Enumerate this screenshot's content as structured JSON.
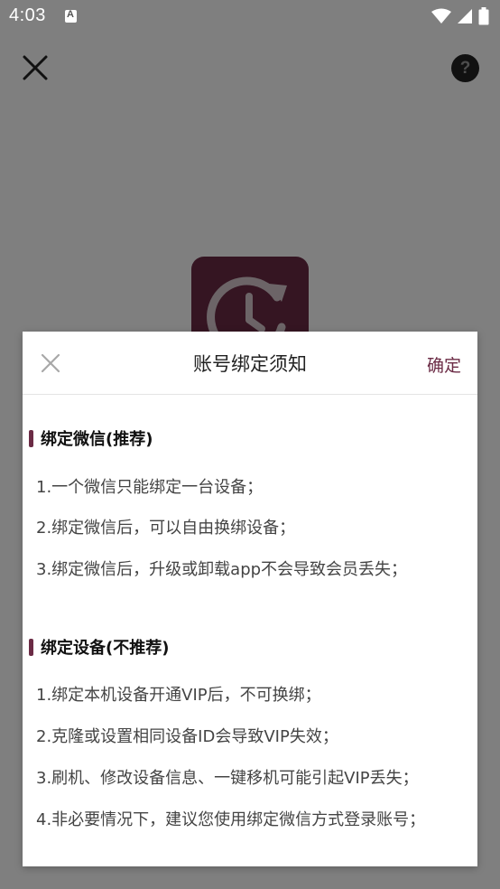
{
  "status_bar": {
    "time": "4:03"
  },
  "page": {
    "help_label": "?"
  },
  "dialog": {
    "title": "账号绑定须知",
    "confirm_label": "确定",
    "sections": [
      {
        "heading": "绑定微信(推荐)",
        "items": [
          "1.一个微信只能绑定一台设备；",
          "2.绑定微信后，可以自由换绑设备；",
          "3.绑定微信后，升级或卸载app不会导致会员丢失；"
        ]
      },
      {
        "heading": "绑定设备(不推荐)",
        "items": [
          "1.绑定本机设备开通VIP后，不可换绑；",
          "2.克隆或设置相同设备ID会导致VIP失效；",
          "3.刷机、修改设备信息、一键移机可能引起VIP丢失；",
          "4.非必要情况下，建议您使用绑定微信方式登录账号；"
        ]
      }
    ]
  },
  "colors": {
    "accent": "#6b2b45",
    "overlay": "rgba(0,0,0,0.5)"
  },
  "icons": {
    "page_close": "close-icon",
    "page_help": "help-icon",
    "dialog_close": "close-icon",
    "app_logo": "clock-refresh-icon",
    "wifi": "wifi-icon",
    "signal": "signal-icon",
    "battery": "battery-icon"
  }
}
